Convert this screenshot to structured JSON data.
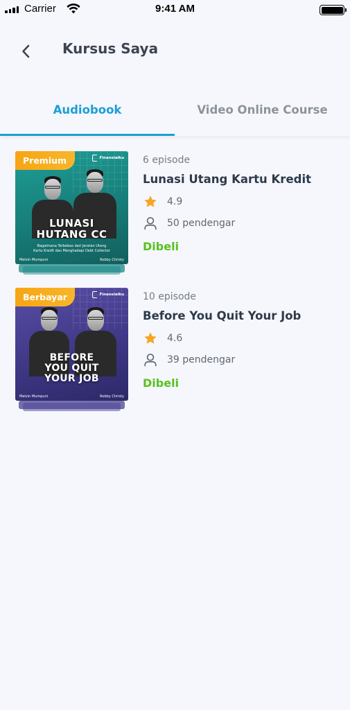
{
  "status_bar": {
    "carrier": "Carrier",
    "time": "9:41 AM"
  },
  "header": {
    "title": "Kursus Saya"
  },
  "tabs": [
    {
      "label": "Audiobook",
      "active": true
    },
    {
      "label": "Video Online Course",
      "active": false
    }
  ],
  "colors": {
    "accent": "#1a9fd6",
    "badge": "#f7a513",
    "purchased": "#57c21e",
    "star": "#f5a623"
  },
  "courses": [
    {
      "badge": "Premium",
      "cover_title": [
        "LUNASI",
        "HUTANG CC"
      ],
      "cover_subtitle": [
        "Bagaimana Terbebas dari Jeratan Utang",
        "Kartu Kredit dan Menghadapi Debt Collector"
      ],
      "cover_logo": "Finansialku",
      "cover_names": [
        "Melvin Mumpuni",
        "Robby Christy"
      ],
      "episodes": "6 episode",
      "title": "Lunasi Utang Kartu Kredit",
      "rating": "4.9",
      "listeners": "50 pendengar",
      "status": "Dibeli"
    },
    {
      "badge": "Berbayar",
      "cover_title": [
        "BEFORE",
        "YOU QUIT",
        "YOUR JOB"
      ],
      "cover_logo": "Finansialku",
      "cover_names": [
        "Melvin Mumpuni",
        "Robby Christy"
      ],
      "episodes": "10 episode",
      "title": "Before You Quit Your Job",
      "rating": "4.6",
      "listeners": "39 pendengar",
      "status": "Dibeli"
    }
  ]
}
